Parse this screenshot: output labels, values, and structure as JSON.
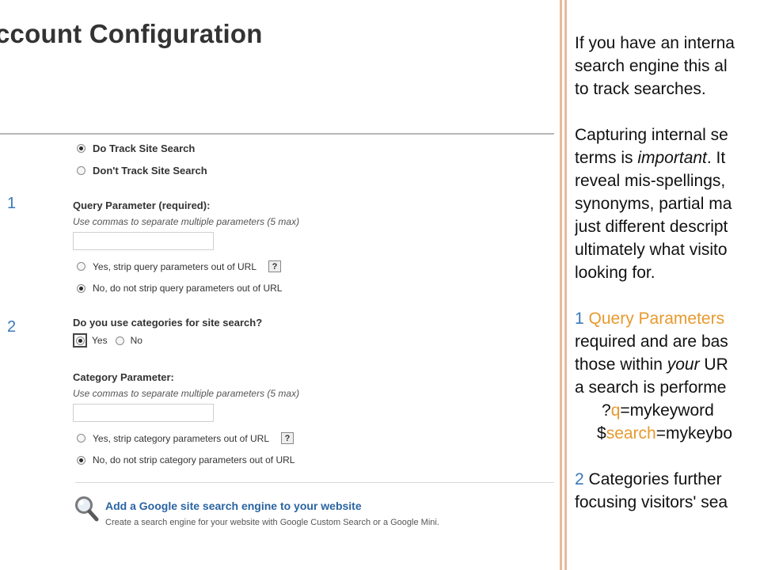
{
  "page": {
    "title": "ccount Configuration"
  },
  "site_search": {
    "track_label": "Do Track Site Search",
    "dont_track_label": "Don't Track Site Search",
    "selected": "track"
  },
  "step1": {
    "number": "1",
    "label": "Query Parameter (required):",
    "hint": "Use commas to separate multiple parameters (5 max)",
    "value": "",
    "strip_yes": "Yes, strip query parameters out of URL",
    "strip_no": "No, do not strip query parameters out of URL",
    "help": "?"
  },
  "step2": {
    "number": "2",
    "question": "Do you use categories for site search?",
    "yes": "Yes",
    "no": "No"
  },
  "category": {
    "label": "Category Parameter:",
    "hint": "Use commas to separate multiple parameters (5 max)",
    "value": "",
    "strip_yes": "Yes, strip category parameters out of URL",
    "strip_no": "No, do not strip category parameters out of URL",
    "help": "?"
  },
  "engine": {
    "link": "Add a Google site search engine to your website",
    "description": "Create a search engine for your website with Google Custom Search or a Google Mini."
  },
  "notes": {
    "p1_l1": "If you have an interna",
    "p1_l2": "search engine this al",
    "p1_l3": "to track searches.",
    "p2_l1": "Capturing internal se",
    "p2_l2a": "terms is ",
    "p2_l2b": "important",
    "p2_l2c": ".  It",
    "p2_l3": "reveal mis-spellings,",
    "p2_l4": "synonyms, partial ma",
    "p2_l5": "just different descript",
    "p2_l6": "ultimately what visito",
    "p2_l7": "looking for.",
    "p3_num": "1",
    "p3_l1": " Query Parameters",
    "p3_l2": "required and are bas",
    "p3_l3a": "those within ",
    "p3_l3b": "your",
    "p3_l3c": " UR",
    "p3_l4": "a search is performe",
    "ex1_a": "?",
    "ex1_b": "q",
    "ex1_c": "=mykeyword",
    "ex2_a": "$",
    "ex2_b": "search",
    "ex2_c": "=mykeybo",
    "p4_num": "2",
    "p4_l1": " Categories further",
    "p4_l2": "focusing visitors' sea"
  },
  "colors": {
    "accent_orange": "#e79a2e",
    "accent_blue": "#3b79b8",
    "link_blue": "#2a64a2",
    "divider": "#e8b99a"
  }
}
